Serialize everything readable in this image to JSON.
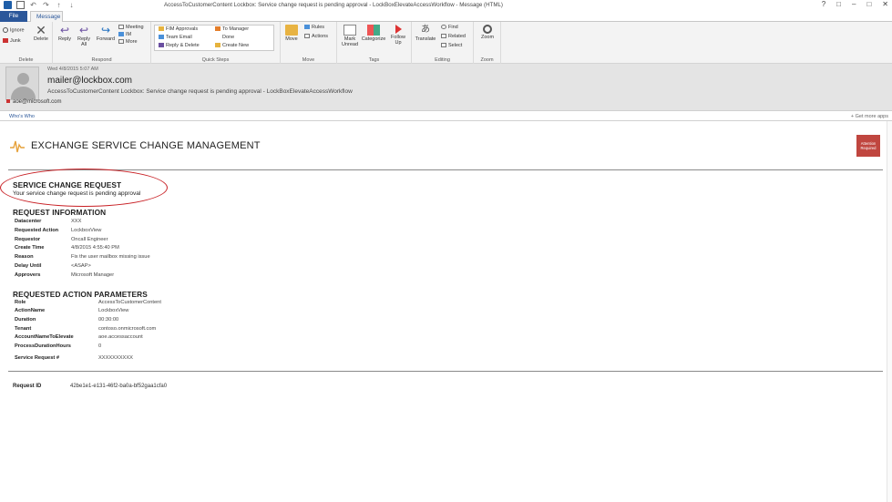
{
  "window": {
    "title": "AccessToCustomerContent Lockbox: Service change request is pending approval - LockBoxElevateAccessWorkflow - Message (HTML)",
    "controls": [
      "?",
      "□",
      "–",
      "□",
      "✕"
    ]
  },
  "tabs": [
    {
      "label": "File"
    },
    {
      "label": "Message"
    }
  ],
  "ribbon": {
    "delete_group": {
      "label": "Delete",
      "ignore": "Ignore",
      "junk": "Junk",
      "delete": "Delete"
    },
    "respond_group": {
      "label": "Respond",
      "reply": "Reply",
      "reply_all_1": "Reply",
      "reply_all_2": "All",
      "forward": "Forward",
      "meeting": "Meeting",
      "im": "IM",
      "more": "More"
    },
    "quicksteps_group": {
      "label": "Quick Steps",
      "items": [
        "FIM Approvals",
        "Team Email",
        "Reply & Delete",
        "To Manager",
        "Done",
        "Create New"
      ]
    },
    "move_group": {
      "label": "Move",
      "move": "Move",
      "rules": "Rules",
      "actions": "Actions"
    },
    "tags_group": {
      "label": "Tags",
      "mark_unread_1": "Mark",
      "mark_unread_2": "Unread",
      "categorize": "Categorize",
      "follow_up_1": "Follow",
      "follow_up_2": "Up"
    },
    "editing_group": {
      "label": "Editing",
      "translate": "Translate",
      "find": "Find",
      "related": "Related",
      "select": "Select"
    },
    "zoom_group": {
      "label": "Zoom",
      "zoom": "Zoom"
    }
  },
  "header": {
    "date": "Wed 4/8/2015 5:07 AM",
    "sender": "mailer@lockbox.com",
    "subject": "AccessToCustomerContent Lockbox: Service change request is pending approval - LockBoxElevateAccessWorkflow",
    "recipient": "aoe@microsoft.com"
  },
  "infobar": {
    "left": "Who's Who",
    "right": "+ Get more apps"
  },
  "email": {
    "banner_title": "EXCHANGE SERVICE CHANGE MANAGEMENT",
    "badge_line1": "Attention",
    "badge_line2": "Required",
    "service_title": "SERVICE CHANGE REQUEST",
    "service_desc": "Your service change request is pending approval",
    "request_info_title": "REQUEST INFORMATION",
    "request_info": [
      {
        "key": "Datacenter",
        "value": "XXX"
      },
      {
        "key": "Requested Action",
        "value": "LockboxView"
      },
      {
        "key": "Requestor",
        "value": "Oncall Engineer"
      },
      {
        "key": "Create Time",
        "value": "4/8/2015 4:55:40 PM"
      },
      {
        "key": "Reason",
        "value": "Fix the user mailbox missing issue"
      },
      {
        "key": "Delay Until",
        "value": "<ASAP>"
      },
      {
        "key": "Approvers",
        "value": "Microsoft Manager"
      }
    ],
    "params_title": "REQUESTED ACTION PARAMETERS",
    "params": [
      {
        "key": "Role",
        "value": "AccessToCustomerContent"
      },
      {
        "key": "ActionName",
        "value": "LockboxView"
      },
      {
        "key": "Duration",
        "value": "00:30:00"
      },
      {
        "key": "Tenant",
        "value": "contoso.onmicrosoft.com"
      },
      {
        "key": "AccountNameToElevate",
        "value": "aoe.accessaccount"
      },
      {
        "key": "ProcessDurationHours",
        "value": "0"
      },
      {
        "key": "Service Request #",
        "value": "XXXXXXXXXX"
      }
    ],
    "request_id_label": "Request ID",
    "request_id": "42be1e1-e131-46f2-ba0a-bf52gaa1cfa0"
  },
  "colors": {
    "accent": "#2b579a",
    "badge": "#c0463f",
    "ellipse": "#c81f24",
    "logo": "#e6a23c"
  }
}
